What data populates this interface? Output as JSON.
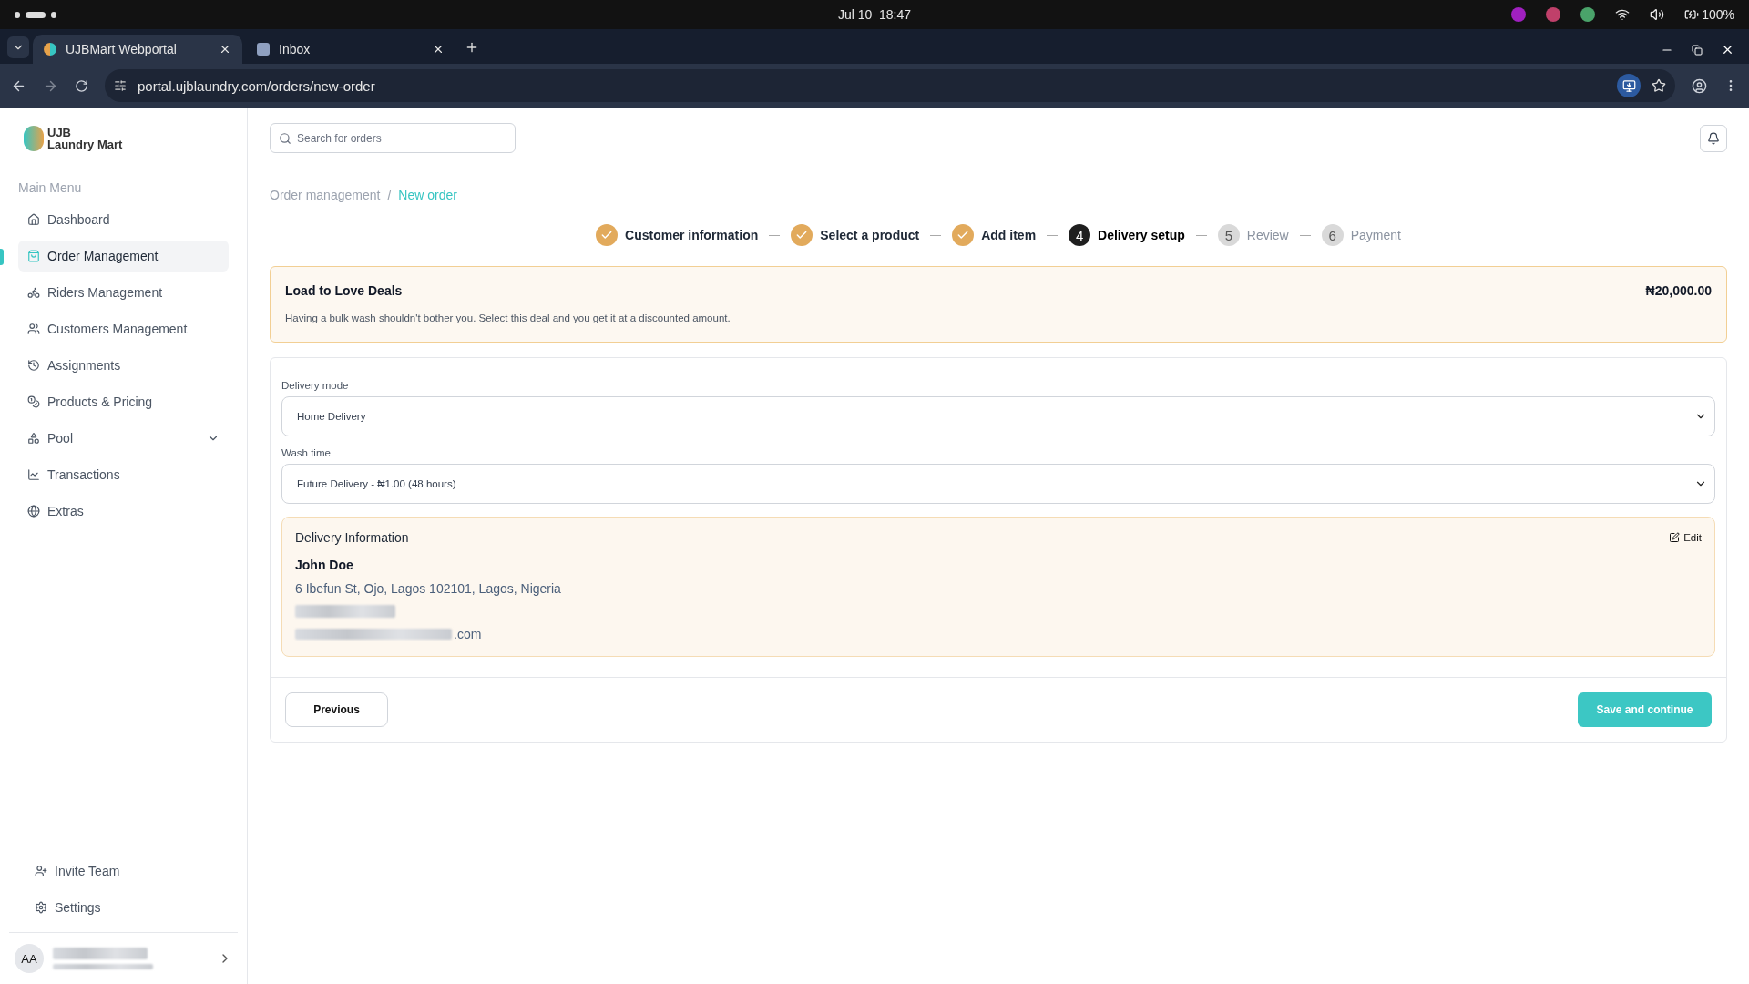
{
  "system_bar": {
    "date": "Jul 10",
    "time": "18:47",
    "battery": "100%"
  },
  "browser": {
    "tabs": [
      {
        "title": "UJBMart Webportal",
        "selected": true
      },
      {
        "title": "Inbox",
        "selected": false
      }
    ],
    "url": "portal.ujblaundry.com/orders/new-order"
  },
  "sidebar": {
    "logo": {
      "line1": "UJB",
      "line2": "Laundry Mart"
    },
    "section": "Main Menu",
    "items": [
      {
        "label": "Dashboard",
        "kind": "link",
        "selected": false
      },
      {
        "label": "Order Management",
        "kind": "link",
        "selected": true
      },
      {
        "label": "Riders Management",
        "kind": "link",
        "selected": false
      },
      {
        "label": "Customers Management",
        "kind": "link",
        "selected": false
      },
      {
        "label": "Assignments",
        "kind": "link",
        "selected": false
      },
      {
        "label": "Products & Pricing",
        "kind": "link",
        "selected": false
      },
      {
        "label": "Pool",
        "kind": "group",
        "selected": false
      },
      {
        "label": "Transactions",
        "kind": "link",
        "selected": false
      },
      {
        "label": "Extras",
        "kind": "link",
        "selected": false
      }
    ],
    "footer_items": [
      {
        "label": "Invite Team"
      },
      {
        "label": "Settings"
      }
    ],
    "user": {
      "initials": "AA"
    }
  },
  "header": {
    "search_placeholder": "Search for orders"
  },
  "breadcrumb": {
    "items": [
      "Order management",
      "New order"
    ],
    "separator": "/"
  },
  "steps": [
    {
      "label": "Customer information",
      "completed": true,
      "selected": false
    },
    {
      "label": "Select a product",
      "completed": true,
      "selected": false
    },
    {
      "label": "Add item",
      "completed": true,
      "selected": false
    },
    {
      "number": "4",
      "label": "Delivery setup",
      "completed": false,
      "selected": true
    },
    {
      "number": "5",
      "label": "Review",
      "completed": false,
      "selected": false
    },
    {
      "number": "6",
      "label": "Payment",
      "completed": false,
      "selected": false
    }
  ],
  "deal": {
    "title": "Load to Love Deals",
    "price": "₦20,000.00",
    "description": "Having a bulk wash shouldn't bother you. Select this deal and you get it at a discounted amount."
  },
  "form": {
    "fields": [
      {
        "label": "Delivery mode",
        "value": "Home Delivery"
      },
      {
        "label": "Wash time",
        "value": "Future Delivery - ₦1.00 (48 hours)"
      }
    ]
  },
  "delivery_info": {
    "title": "Delivery Information",
    "edit": "Edit",
    "name": "John Doe",
    "address": "6 Ibefun St, Ojo, Lagos 102101, Lagos, Nigeria",
    "email_suffix": ".com"
  },
  "actions": {
    "previous": "Previous",
    "save": "Save and continue"
  }
}
